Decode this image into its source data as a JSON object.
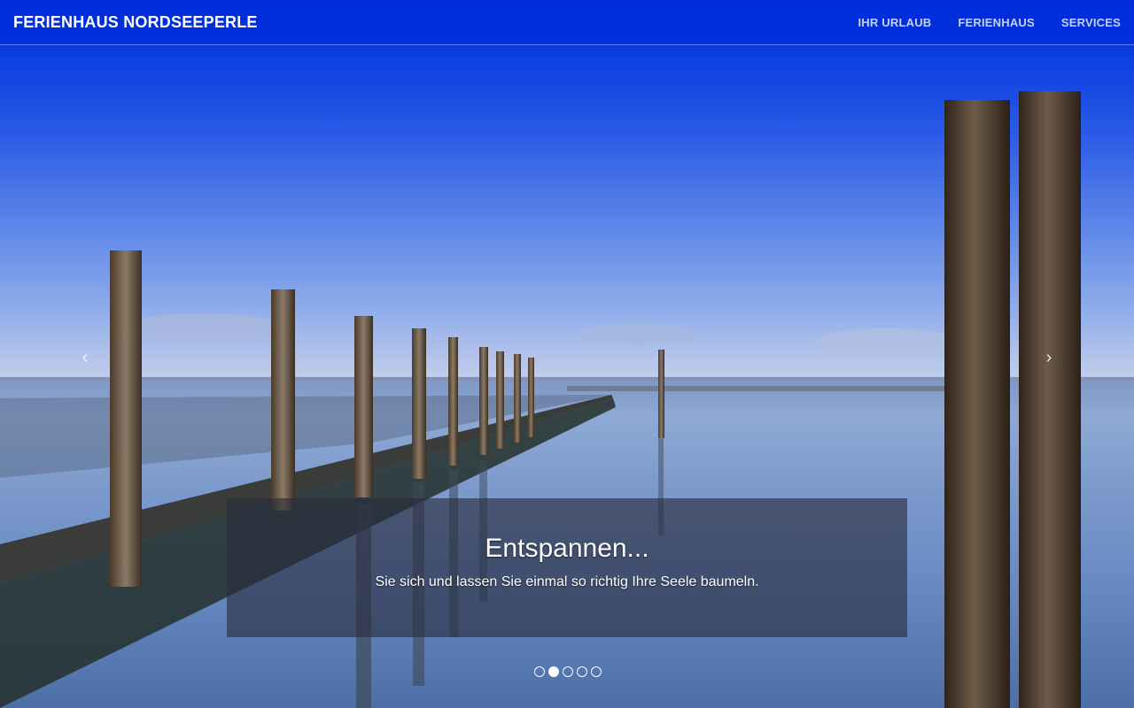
{
  "header": {
    "brand": "FERIENHAUS NORDSEEPERLE",
    "nav": [
      {
        "label": "IHR URLAUB"
      },
      {
        "label": "FERIENHAUS"
      },
      {
        "label": "SERVICES"
      }
    ]
  },
  "carousel": {
    "prev_glyph": "‹",
    "next_glyph": "›",
    "slide": {
      "title": "Entspannen...",
      "text": "Sie sich und lassen Sie einmal so richtig Ihre Seele baumeln."
    },
    "indicators": {
      "count": 5,
      "active_index": 1
    }
  }
}
